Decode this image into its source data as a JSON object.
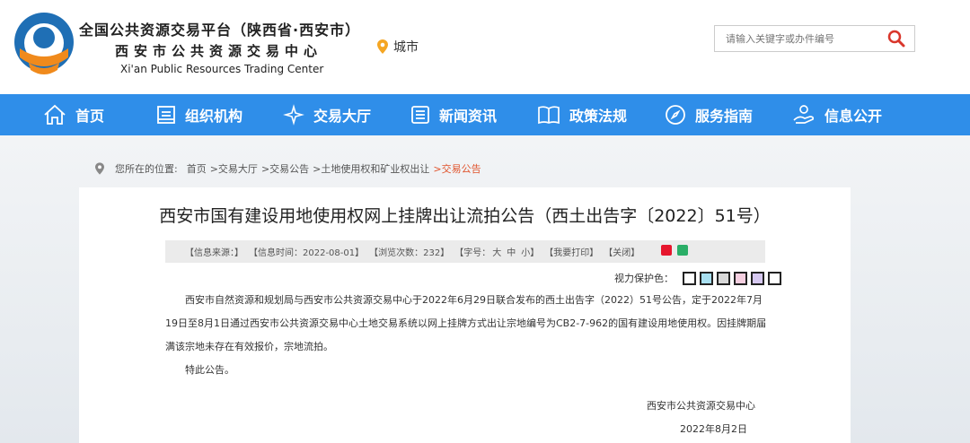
{
  "header": {
    "title_cn": "全国公共资源交易平台（陕西省·西安市）",
    "subtitle_cn": "西安市公共资源交易中心",
    "title_en": "Xi'an Public Resources Trading Center",
    "city_label": "城市",
    "search_placeholder": "请输入关键字或办件编号"
  },
  "nav": {
    "items": [
      {
        "label": "首页",
        "icon": "home-icon"
      },
      {
        "label": "组织机构",
        "icon": "org-icon"
      },
      {
        "label": "交易大厅",
        "icon": "trade-icon"
      },
      {
        "label": "新闻资讯",
        "icon": "news-icon"
      },
      {
        "label": "政策法规",
        "icon": "book-icon"
      },
      {
        "label": "服务指南",
        "icon": "compass-icon"
      },
      {
        "label": "信息公开",
        "icon": "info-icon"
      }
    ]
  },
  "breadcrumb": {
    "prefix": "您所在的位置:",
    "items": [
      "首页",
      ">交易大厅",
      ">交易公告",
      ">土地使用权和矿业权出让",
      ">交易公告"
    ]
  },
  "article": {
    "title": "西安市国有建设用地使用权网上挂牌出让流拍公告（西土出告字〔2022〕51号）",
    "meta": {
      "source": "【信息来源：】",
      "time": "【信息时间：2022-08-01】",
      "views": "【浏览次数：232】",
      "font_prefix": "【字号：",
      "font_big": "大",
      "font_mid": "中",
      "font_small": "小】",
      "print": "【我要打印】",
      "close": "【关闭】"
    },
    "vision_label": "视力保护色：",
    "vision_colors": [
      "#ffffff",
      "#a8dff0",
      "#d8d8d8",
      "#f5cfe0",
      "#d6c8f0",
      "#ffffff"
    ],
    "paragraph1": "西安市自然资源和规划局与西安市公共资源交易中心于2022年6月29日联合发布的西土出告字（2022）51号公告，定于2022年7月19日至8月1日通过西安市公共资源交易中心土地交易系统以网上挂牌方式出让宗地编号为CB2-7-962的国有建设用地使用权。因挂牌期届满该宗地未存在有效报价，宗地流拍。",
    "paragraph2": "特此公告。",
    "signature": "西安市公共资源交易中心",
    "date": "2022年8月2日"
  },
  "colors": {
    "nav_bg": "#2f8ee9",
    "logo_orange": "#f08a1c",
    "logo_blue": "#1f6fb5",
    "breadcrumb_current": "#e0532c"
  }
}
